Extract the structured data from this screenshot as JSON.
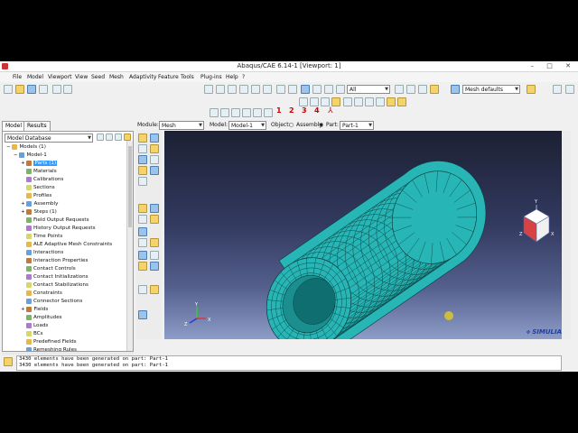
{
  "window": {
    "title": "Abaqus/CAE 6.14-1 [Viewport: 1]",
    "buttons": [
      "–",
      "□",
      "✕"
    ]
  },
  "menu": [
    "File",
    "Model",
    "Viewport",
    "View",
    "Seed",
    "Mesh",
    "Adaptivity",
    "Feature",
    "Tools",
    "Plug-ins",
    "Help",
    "?"
  ],
  "toolbar": {
    "selection_filter": "All",
    "mesh_display": "Mesh defaults",
    "numbers": [
      "1",
      "2",
      "3",
      "4"
    ]
  },
  "tabs": {
    "model": "Model",
    "results": "Results"
  },
  "context": {
    "module_label": "Module:",
    "module_value": "Mesh",
    "model_label": "Model:",
    "model_value": "Model-1",
    "object_label": "Object:",
    "assembly_label": "Assembly",
    "part_label": "Part:",
    "part_value": "Part-1"
  },
  "tree": {
    "database": "Model Database",
    "items": [
      {
        "label": "Models (1)",
        "level": 0,
        "exp": "−"
      },
      {
        "label": "Model-1",
        "level": 1,
        "exp": "−"
      },
      {
        "label": "Parts (1)",
        "level": 2,
        "exp": "+",
        "selected": true
      },
      {
        "label": "Materials",
        "level": 2
      },
      {
        "label": "Calibrations",
        "level": 2
      },
      {
        "label": "Sections",
        "level": 2
      },
      {
        "label": "Profiles",
        "level": 2
      },
      {
        "label": "Assembly",
        "level": 2,
        "exp": "+"
      },
      {
        "label": "Steps (1)",
        "level": 2,
        "exp": "+"
      },
      {
        "label": "Field Output Requests",
        "level": 2
      },
      {
        "label": "History Output Requests",
        "level": 2
      },
      {
        "label": "Time Points",
        "level": 2
      },
      {
        "label": "ALE Adaptive Mesh Constraints",
        "level": 2
      },
      {
        "label": "Interactions",
        "level": 2
      },
      {
        "label": "Interaction Properties",
        "level": 2
      },
      {
        "label": "Contact Controls",
        "level": 2
      },
      {
        "label": "Contact Initializations",
        "level": 2
      },
      {
        "label": "Contact Stabilizations",
        "level": 2
      },
      {
        "label": "Constraints",
        "level": 2
      },
      {
        "label": "Connector Sections",
        "level": 2
      },
      {
        "label": "Fields",
        "level": 2,
        "exp": "+"
      },
      {
        "label": "Amplitudes",
        "level": 2
      },
      {
        "label": "Loads",
        "level": 2
      },
      {
        "label": "BCs",
        "level": 2
      },
      {
        "label": "Predefined Fields",
        "level": 2
      },
      {
        "label": "Remeshing Rules",
        "level": 2
      }
    ]
  },
  "viewport": {
    "axes": {
      "x": "X",
      "y": "Y",
      "z": "Z"
    },
    "brand": "SIMULIA"
  },
  "messages": [
    "3430 elements have been generated on part: Part-1",
    "3430 elements have been generated on part: Part-1"
  ],
  "colors": {
    "mesh_fill": "#27b5b5",
    "mesh_line": "#0a3c3c",
    "selection": "#3399ff"
  }
}
